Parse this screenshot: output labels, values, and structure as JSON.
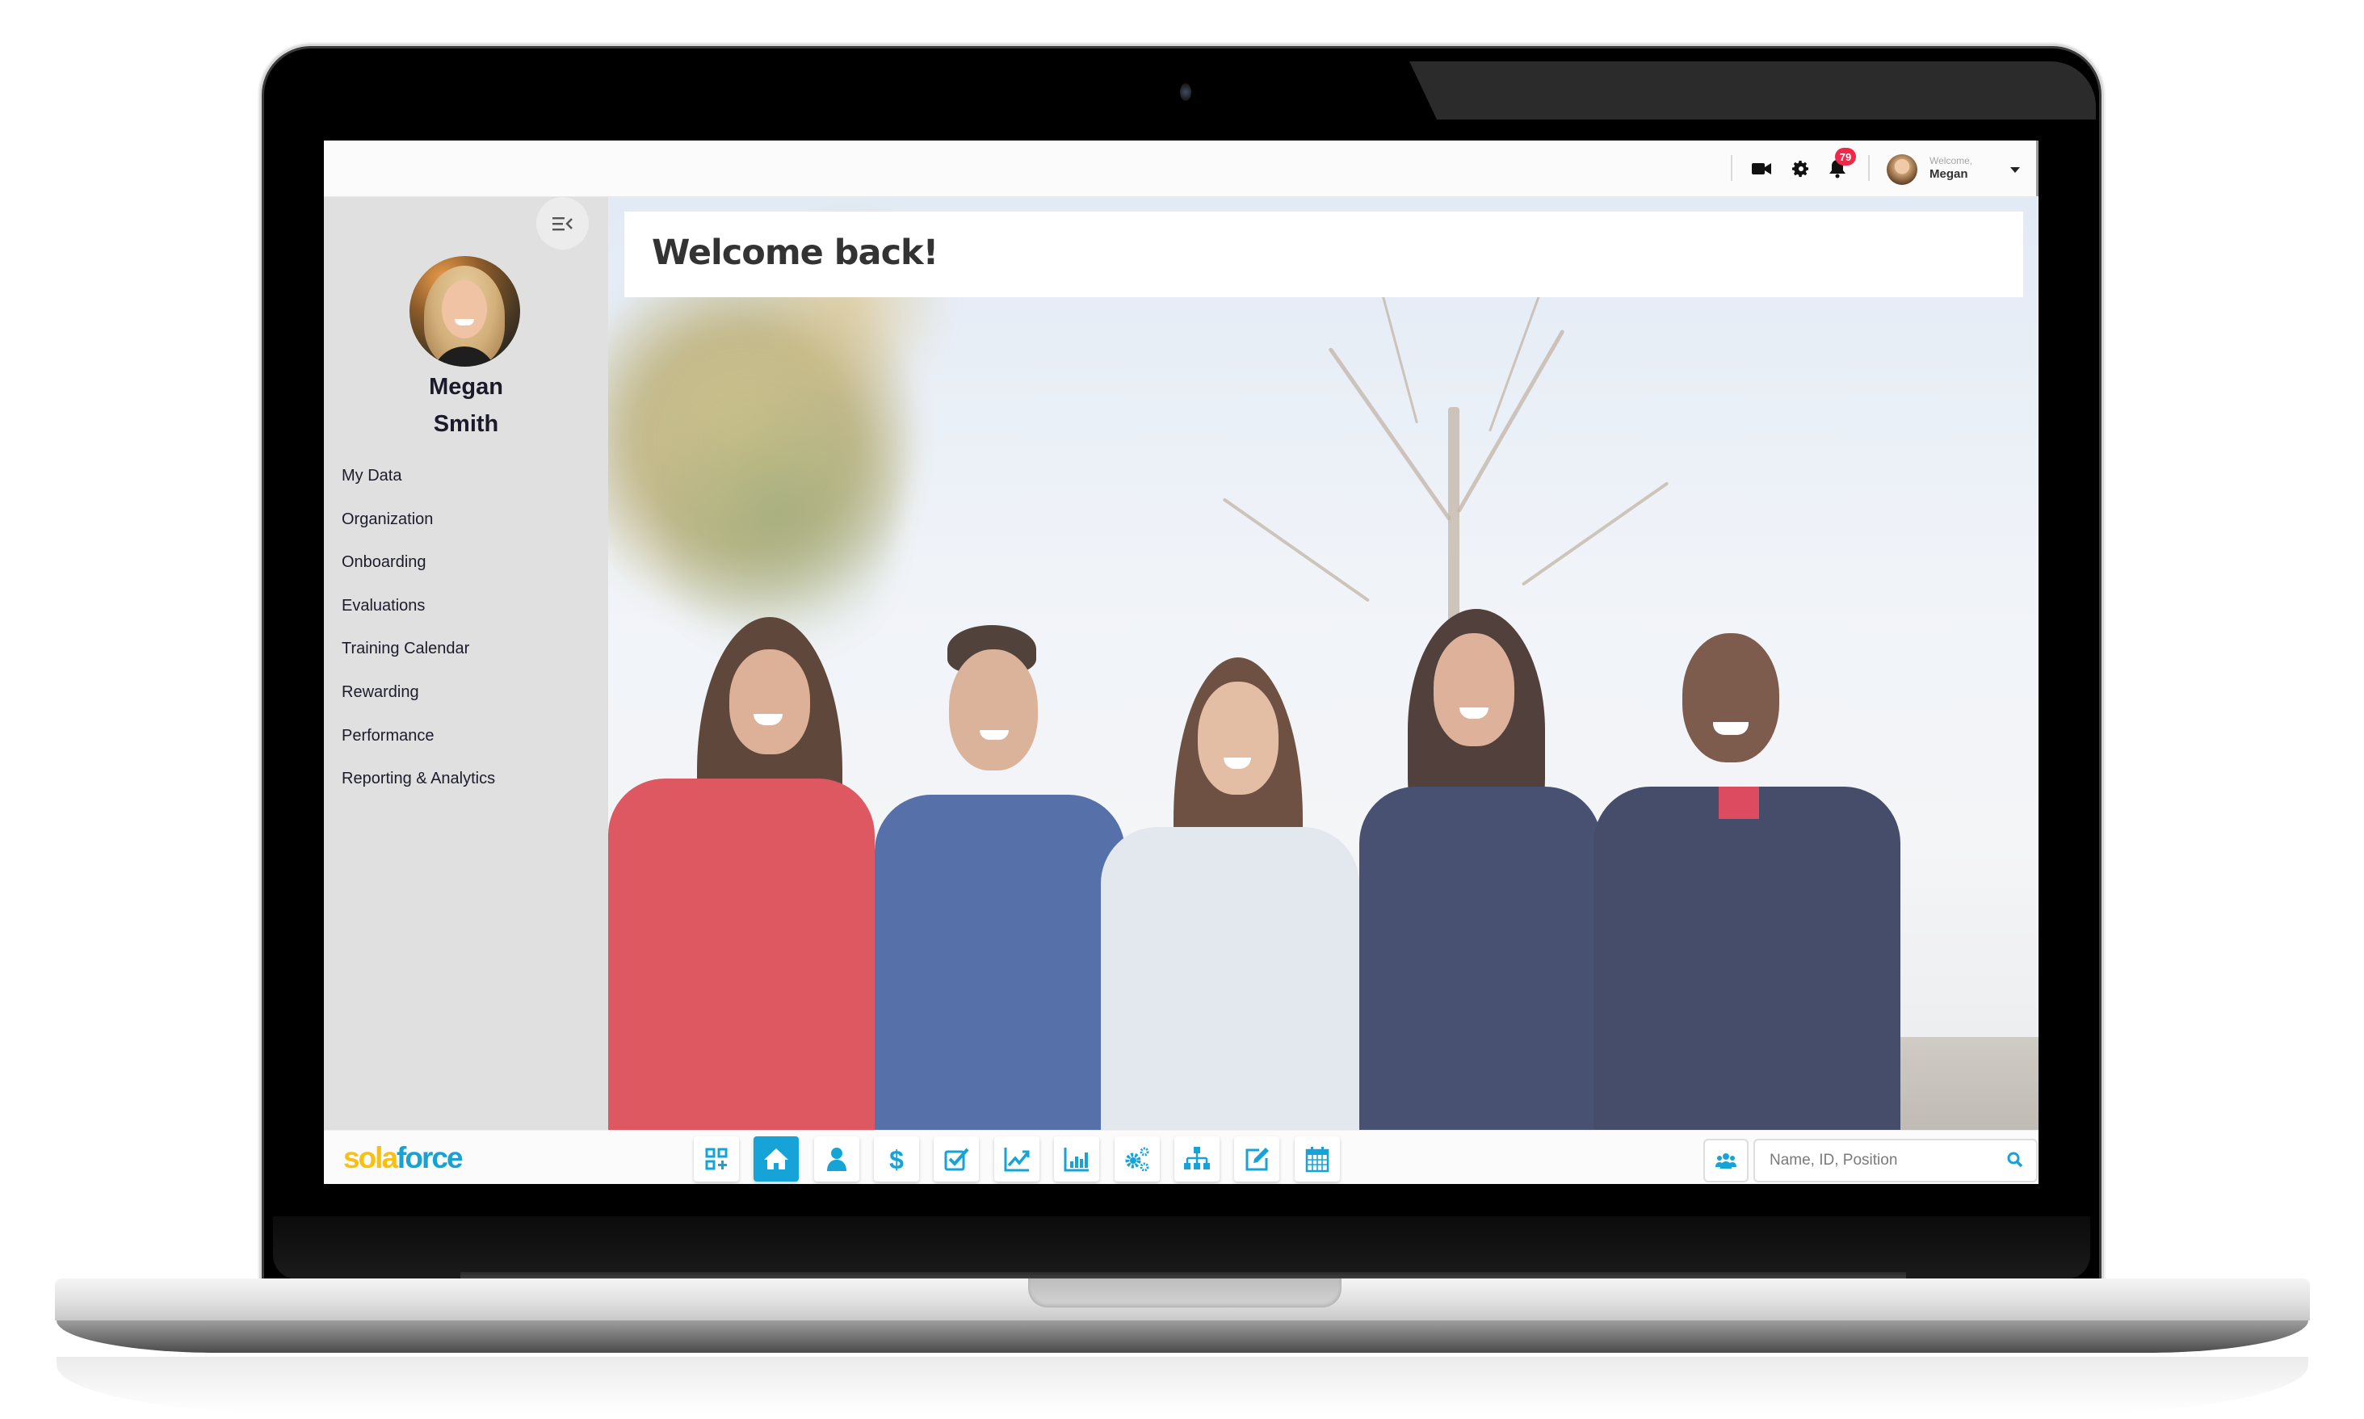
{
  "header": {
    "icons": [
      {
        "name": "video-camera-icon"
      },
      {
        "name": "settings-gear-icon"
      },
      {
        "name": "notifications-bell-icon"
      }
    ],
    "notification_count": "79",
    "welcome_label": "Welcome,",
    "user_first_name": "Megan"
  },
  "sidebar": {
    "collapse_icon": "collapse-menu-icon",
    "profile": {
      "first_name": "Megan",
      "last_name": "Smith"
    },
    "items": [
      {
        "label": "My Data"
      },
      {
        "label": "Organization"
      },
      {
        "label": "Onboarding"
      },
      {
        "label": "Evaluations"
      },
      {
        "label": "Training Calendar"
      },
      {
        "label": "Rewarding"
      },
      {
        "label": "Performance"
      },
      {
        "label": "Reporting & Analytics"
      }
    ]
  },
  "main": {
    "welcome_title": "Welcome back!",
    "hero_image": "group-of-five-smiling-people-outdoors"
  },
  "footer": {
    "logo": {
      "part1": "sola",
      "part2": "force"
    },
    "toolbar": [
      {
        "icon": "dashboard-add-icon",
        "active": false
      },
      {
        "icon": "home-icon",
        "active": true
      },
      {
        "icon": "user-icon",
        "active": false
      },
      {
        "icon": "dollar-icon",
        "active": false
      },
      {
        "icon": "checkbox-icon",
        "active": false
      },
      {
        "icon": "trend-line-icon",
        "active": false
      },
      {
        "icon": "bar-chart-icon",
        "active": false
      },
      {
        "icon": "gears-icon",
        "active": false
      },
      {
        "icon": "org-chart-icon",
        "active": false
      },
      {
        "icon": "edit-icon",
        "active": false
      },
      {
        "icon": "calendar-icon",
        "active": false
      }
    ],
    "group_icon": "people-group-icon",
    "search": {
      "placeholder": "Name, ID, Position",
      "value": ""
    }
  },
  "colors": {
    "brand_blue": "#16a4d8",
    "brand_yellow": "#fbbf0e",
    "badge_red": "#f0284a",
    "sidebar_bg": "#e0e0e0"
  }
}
